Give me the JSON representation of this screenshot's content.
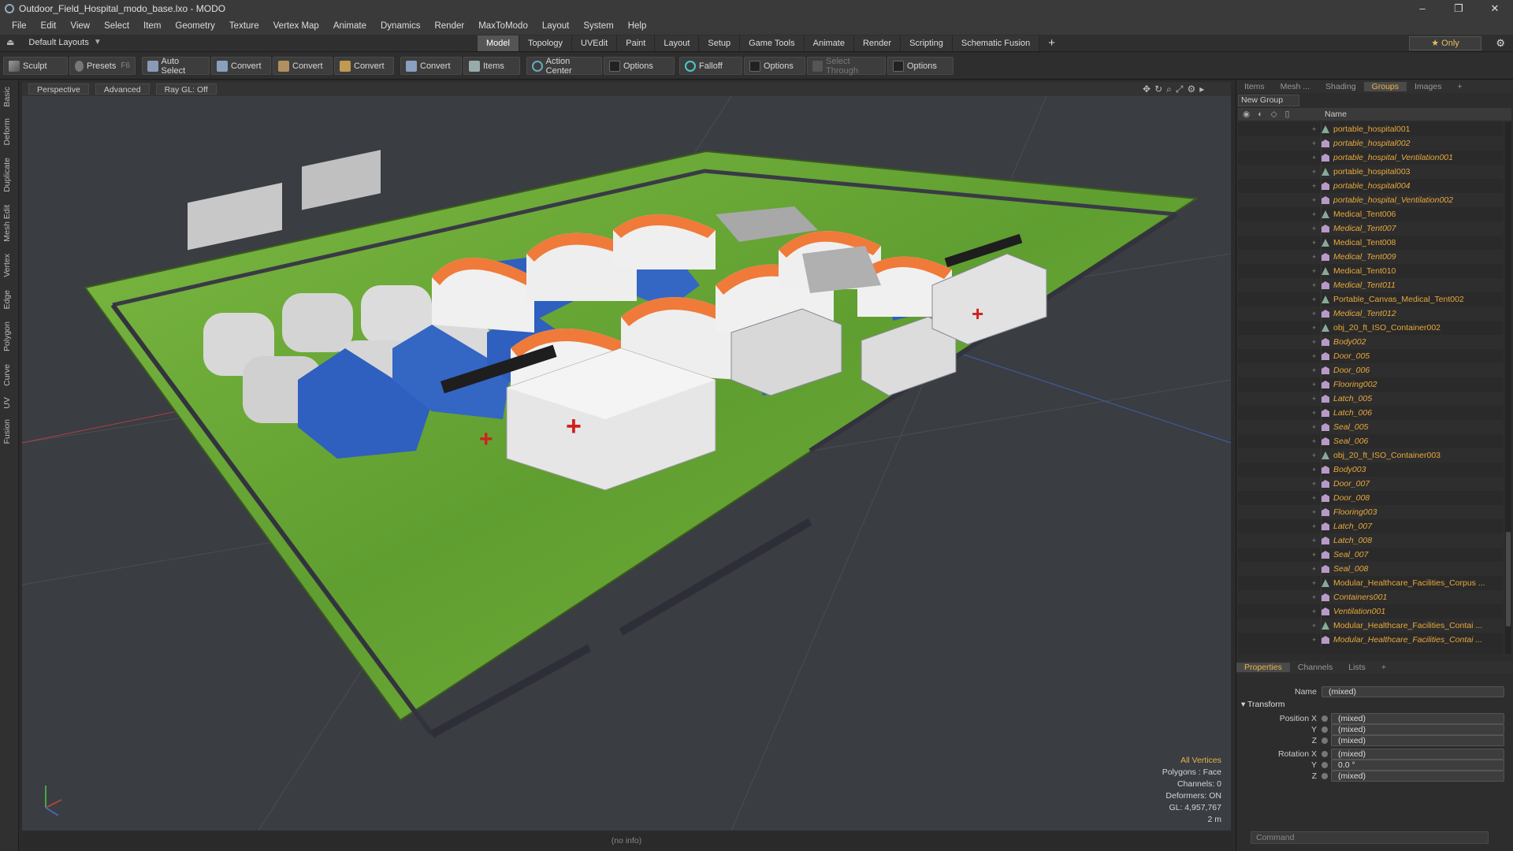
{
  "window": {
    "title": "Outdoor_Field_Hospital_modo_base.lxo - MODO",
    "controls": [
      "–",
      "❐",
      "✕"
    ]
  },
  "menu": [
    "File",
    "Edit",
    "View",
    "Select",
    "Item",
    "Geometry",
    "Texture",
    "Vertex Map",
    "Animate",
    "Dynamics",
    "Render",
    "MaxToModo",
    "Layout",
    "System",
    "Help"
  ],
  "layout": {
    "default_layouts": "Default Layouts",
    "tabs": [
      "Model",
      "Topology",
      "UVEdit",
      "Paint",
      "Layout",
      "Setup",
      "Game Tools",
      "Animate",
      "Render",
      "Scripting",
      "Schematic Fusion"
    ],
    "active_tab": "Model",
    "only_label": "Only"
  },
  "toolbar": {
    "sculpt": "Sculpt",
    "presets": "Presets",
    "presets_key": "F6",
    "auto_select": "Auto Select",
    "convert1": "Convert",
    "convert2": "Convert",
    "convert3": "Convert",
    "convert4": "Convert",
    "items": "Items",
    "action_center": "Action Center",
    "options1": "Options",
    "falloff": "Falloff",
    "options2": "Options",
    "select_through": "Select Through",
    "options3": "Options"
  },
  "left_tabs": [
    "Basic",
    "Deform",
    "Duplicate",
    "Mesh Edit",
    "Vertex",
    "Edge",
    "Polygon",
    "Curve",
    "UV",
    "Fusion"
  ],
  "viewport": {
    "view": "Perspective",
    "shading": "Advanced",
    "raygl": "Ray GL: Off",
    "info": {
      "all_vertices": "All Vertices",
      "polygons": "Polygons : Face",
      "channels": "Channels: 0",
      "deformers": "Deformers: ON",
      "gl": "GL: 4,957,767",
      "scale": "2 m"
    },
    "status": "(no info)"
  },
  "right_panel": {
    "tabs": [
      "Items",
      "Mesh ...",
      "Shading",
      "Groups",
      "Images"
    ],
    "active_tab": "Groups",
    "new_group": "New Group",
    "name_col": "Name",
    "items": [
      {
        "name": "portable_hospital001",
        "italic": false
      },
      {
        "name": "portable_hospital002",
        "italic": true
      },
      {
        "name": "portable_hospital_Ventilation001",
        "italic": true
      },
      {
        "name": "portable_hospital003",
        "italic": false
      },
      {
        "name": "portable_hospital004",
        "italic": true
      },
      {
        "name": "portable_hospital_Ventilation002",
        "italic": true
      },
      {
        "name": "Medical_Tent006",
        "italic": false
      },
      {
        "name": "Medical_Tent007",
        "italic": true
      },
      {
        "name": "Medical_Tent008",
        "italic": false
      },
      {
        "name": "Medical_Tent009",
        "italic": true
      },
      {
        "name": "Medical_Tent010",
        "italic": false
      },
      {
        "name": "Medical_Tent011",
        "italic": true
      },
      {
        "name": "Portable_Canvas_Medical_Tent002",
        "italic": false
      },
      {
        "name": "Medical_Tent012",
        "italic": true
      },
      {
        "name": "obj_20_ft_ISO_Container002",
        "italic": false
      },
      {
        "name": "Body002",
        "italic": true
      },
      {
        "name": "Door_005",
        "italic": true
      },
      {
        "name": "Door_006",
        "italic": true
      },
      {
        "name": "Flooring002",
        "italic": true
      },
      {
        "name": "Latch_005",
        "italic": true
      },
      {
        "name": "Latch_006",
        "italic": true
      },
      {
        "name": "Seal_005",
        "italic": true
      },
      {
        "name": "Seal_006",
        "italic": true
      },
      {
        "name": "obj_20_ft_ISO_Container003",
        "italic": false
      },
      {
        "name": "Body003",
        "italic": true
      },
      {
        "name": "Door_007",
        "italic": true
      },
      {
        "name": "Door_008",
        "italic": true
      },
      {
        "name": "Flooring003",
        "italic": true
      },
      {
        "name": "Latch_007",
        "italic": true
      },
      {
        "name": "Latch_008",
        "italic": true
      },
      {
        "name": "Seal_007",
        "italic": true
      },
      {
        "name": "Seal_008",
        "italic": true
      },
      {
        "name": "Modular_Healthcare_Facilities_Corpus ...",
        "italic": false
      },
      {
        "name": "Containers001",
        "italic": true
      },
      {
        "name": "Ventilation001",
        "italic": true
      },
      {
        "name": "Modular_Healthcare_Facilities_Contai ...",
        "italic": false
      },
      {
        "name": "Modular_Healthcare_Facilities_Contai ...",
        "italic": true
      }
    ]
  },
  "properties": {
    "tabs": [
      "Properties",
      "Channels",
      "Lists"
    ],
    "active_tab": "Properties",
    "name_label": "Name",
    "name_value": "(mixed)",
    "transform": "Transform",
    "position_label": "Position X",
    "rotation_label": "Rotation X",
    "y": "Y",
    "z": "Z",
    "pos_x": "(mixed)",
    "pos_y": "(mixed)",
    "pos_z": "(mixed)",
    "rot_x": "(mixed)",
    "rot_y": "0.0 °",
    "rot_z": "(mixed)",
    "command_placeholder": "Command"
  },
  "colors": {
    "accent": "#e8b04a",
    "ground": "#6aa838",
    "tent_blue": "#2f5fbf",
    "tent_orange": "#f07a3a"
  }
}
